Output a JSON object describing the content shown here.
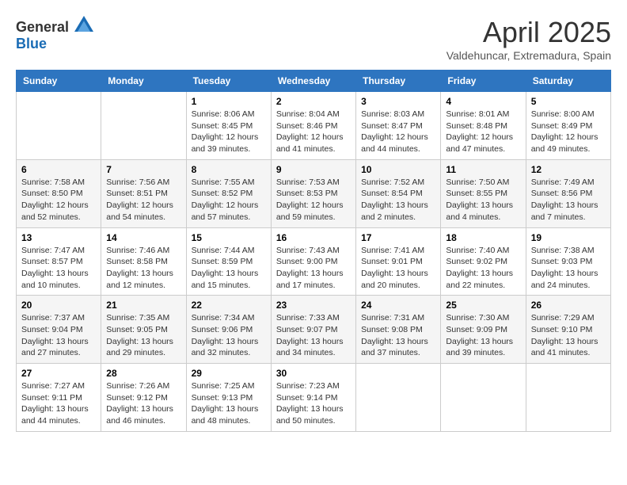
{
  "header": {
    "logo_general": "General",
    "logo_blue": "Blue",
    "month_title": "April 2025",
    "subtitle": "Valdehuncar, Extremadura, Spain"
  },
  "weekdays": [
    "Sunday",
    "Monday",
    "Tuesday",
    "Wednesday",
    "Thursday",
    "Friday",
    "Saturday"
  ],
  "weeks": [
    [
      {
        "day": "",
        "info": ""
      },
      {
        "day": "",
        "info": ""
      },
      {
        "day": "1",
        "info": "Sunrise: 8:06 AM\nSunset: 8:45 PM\nDaylight: 12 hours and 39 minutes."
      },
      {
        "day": "2",
        "info": "Sunrise: 8:04 AM\nSunset: 8:46 PM\nDaylight: 12 hours and 41 minutes."
      },
      {
        "day": "3",
        "info": "Sunrise: 8:03 AM\nSunset: 8:47 PM\nDaylight: 12 hours and 44 minutes."
      },
      {
        "day": "4",
        "info": "Sunrise: 8:01 AM\nSunset: 8:48 PM\nDaylight: 12 hours and 47 minutes."
      },
      {
        "day": "5",
        "info": "Sunrise: 8:00 AM\nSunset: 8:49 PM\nDaylight: 12 hours and 49 minutes."
      }
    ],
    [
      {
        "day": "6",
        "info": "Sunrise: 7:58 AM\nSunset: 8:50 PM\nDaylight: 12 hours and 52 minutes."
      },
      {
        "day": "7",
        "info": "Sunrise: 7:56 AM\nSunset: 8:51 PM\nDaylight: 12 hours and 54 minutes."
      },
      {
        "day": "8",
        "info": "Sunrise: 7:55 AM\nSunset: 8:52 PM\nDaylight: 12 hours and 57 minutes."
      },
      {
        "day": "9",
        "info": "Sunrise: 7:53 AM\nSunset: 8:53 PM\nDaylight: 12 hours and 59 minutes."
      },
      {
        "day": "10",
        "info": "Sunrise: 7:52 AM\nSunset: 8:54 PM\nDaylight: 13 hours and 2 minutes."
      },
      {
        "day": "11",
        "info": "Sunrise: 7:50 AM\nSunset: 8:55 PM\nDaylight: 13 hours and 4 minutes."
      },
      {
        "day": "12",
        "info": "Sunrise: 7:49 AM\nSunset: 8:56 PM\nDaylight: 13 hours and 7 minutes."
      }
    ],
    [
      {
        "day": "13",
        "info": "Sunrise: 7:47 AM\nSunset: 8:57 PM\nDaylight: 13 hours and 10 minutes."
      },
      {
        "day": "14",
        "info": "Sunrise: 7:46 AM\nSunset: 8:58 PM\nDaylight: 13 hours and 12 minutes."
      },
      {
        "day": "15",
        "info": "Sunrise: 7:44 AM\nSunset: 8:59 PM\nDaylight: 13 hours and 15 minutes."
      },
      {
        "day": "16",
        "info": "Sunrise: 7:43 AM\nSunset: 9:00 PM\nDaylight: 13 hours and 17 minutes."
      },
      {
        "day": "17",
        "info": "Sunrise: 7:41 AM\nSunset: 9:01 PM\nDaylight: 13 hours and 20 minutes."
      },
      {
        "day": "18",
        "info": "Sunrise: 7:40 AM\nSunset: 9:02 PM\nDaylight: 13 hours and 22 minutes."
      },
      {
        "day": "19",
        "info": "Sunrise: 7:38 AM\nSunset: 9:03 PM\nDaylight: 13 hours and 24 minutes."
      }
    ],
    [
      {
        "day": "20",
        "info": "Sunrise: 7:37 AM\nSunset: 9:04 PM\nDaylight: 13 hours and 27 minutes."
      },
      {
        "day": "21",
        "info": "Sunrise: 7:35 AM\nSunset: 9:05 PM\nDaylight: 13 hours and 29 minutes."
      },
      {
        "day": "22",
        "info": "Sunrise: 7:34 AM\nSunset: 9:06 PM\nDaylight: 13 hours and 32 minutes."
      },
      {
        "day": "23",
        "info": "Sunrise: 7:33 AM\nSunset: 9:07 PM\nDaylight: 13 hours and 34 minutes."
      },
      {
        "day": "24",
        "info": "Sunrise: 7:31 AM\nSunset: 9:08 PM\nDaylight: 13 hours and 37 minutes."
      },
      {
        "day": "25",
        "info": "Sunrise: 7:30 AM\nSunset: 9:09 PM\nDaylight: 13 hours and 39 minutes."
      },
      {
        "day": "26",
        "info": "Sunrise: 7:29 AM\nSunset: 9:10 PM\nDaylight: 13 hours and 41 minutes."
      }
    ],
    [
      {
        "day": "27",
        "info": "Sunrise: 7:27 AM\nSunset: 9:11 PM\nDaylight: 13 hours and 44 minutes."
      },
      {
        "day": "28",
        "info": "Sunrise: 7:26 AM\nSunset: 9:12 PM\nDaylight: 13 hours and 46 minutes."
      },
      {
        "day": "29",
        "info": "Sunrise: 7:25 AM\nSunset: 9:13 PM\nDaylight: 13 hours and 48 minutes."
      },
      {
        "day": "30",
        "info": "Sunrise: 7:23 AM\nSunset: 9:14 PM\nDaylight: 13 hours and 50 minutes."
      },
      {
        "day": "",
        "info": ""
      },
      {
        "day": "",
        "info": ""
      },
      {
        "day": "",
        "info": ""
      }
    ]
  ]
}
